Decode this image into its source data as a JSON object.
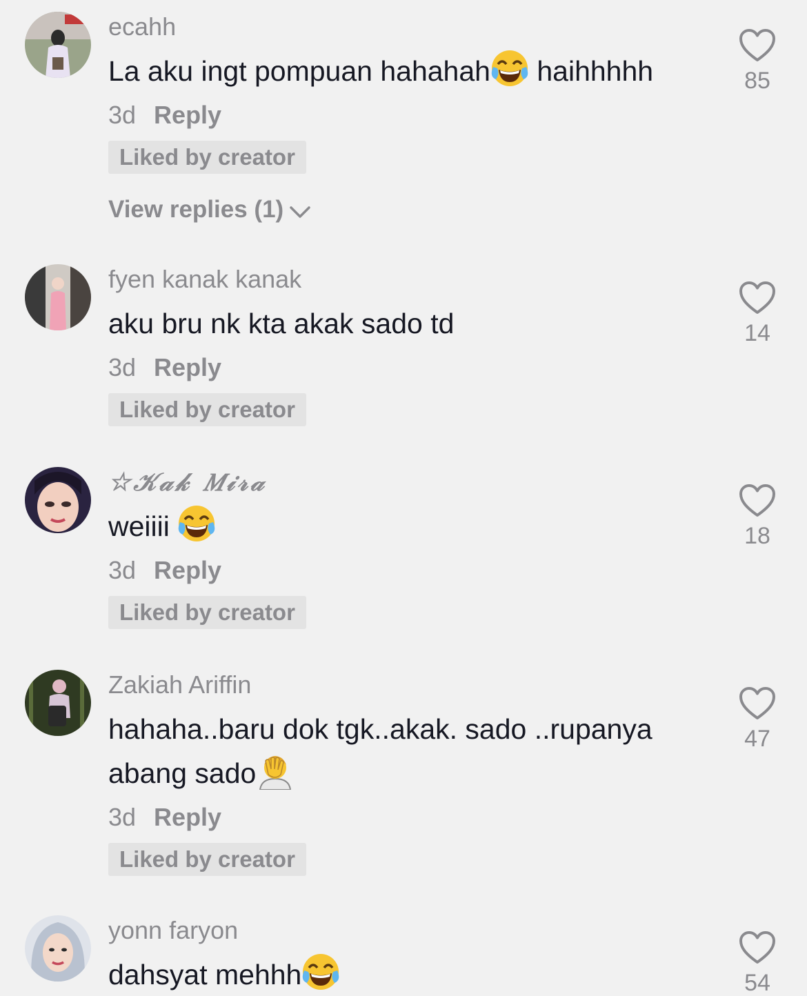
{
  "comments": [
    {
      "username": "ecahh",
      "text_before": "La aku ingt pompuan hahahah",
      "emoji": "face-with-tears-of-joy-emoji",
      "text_after": " haihhhhh",
      "time": "3d",
      "reply_label": "Reply",
      "badge": "Liked by creator",
      "view_replies": "View replies (1)",
      "likes": "85"
    },
    {
      "username": "fyen kanak kanak",
      "text_before": "aku bru nk kta akak sado td",
      "time": "3d",
      "reply_label": "Reply",
      "badge": "Liked by creator",
      "likes": "14"
    },
    {
      "username": "☆𝒦𝒶𝓀 𝑀𝒾𝓇𝒶",
      "text_before": "weiiii ",
      "emoji": "face-with-tears-of-joy-emoji",
      "time": "3d",
      "reply_label": "Reply",
      "badge": "Liked by creator",
      "likes": "18"
    },
    {
      "username": "Zakiah Ariffin",
      "text_before": "hahaha..baru dok tgk..akak. sado ..rupanya abang sado",
      "emoji": "facepalm-emoji",
      "time": "3d",
      "reply_label": "Reply",
      "badge": "Liked by creator",
      "likes": "47"
    },
    {
      "username": "yonn faryon",
      "text_before": "dahsyat mehhh",
      "emoji": "face-with-tears-of-joy-emoji",
      "likes": "54"
    }
  ]
}
